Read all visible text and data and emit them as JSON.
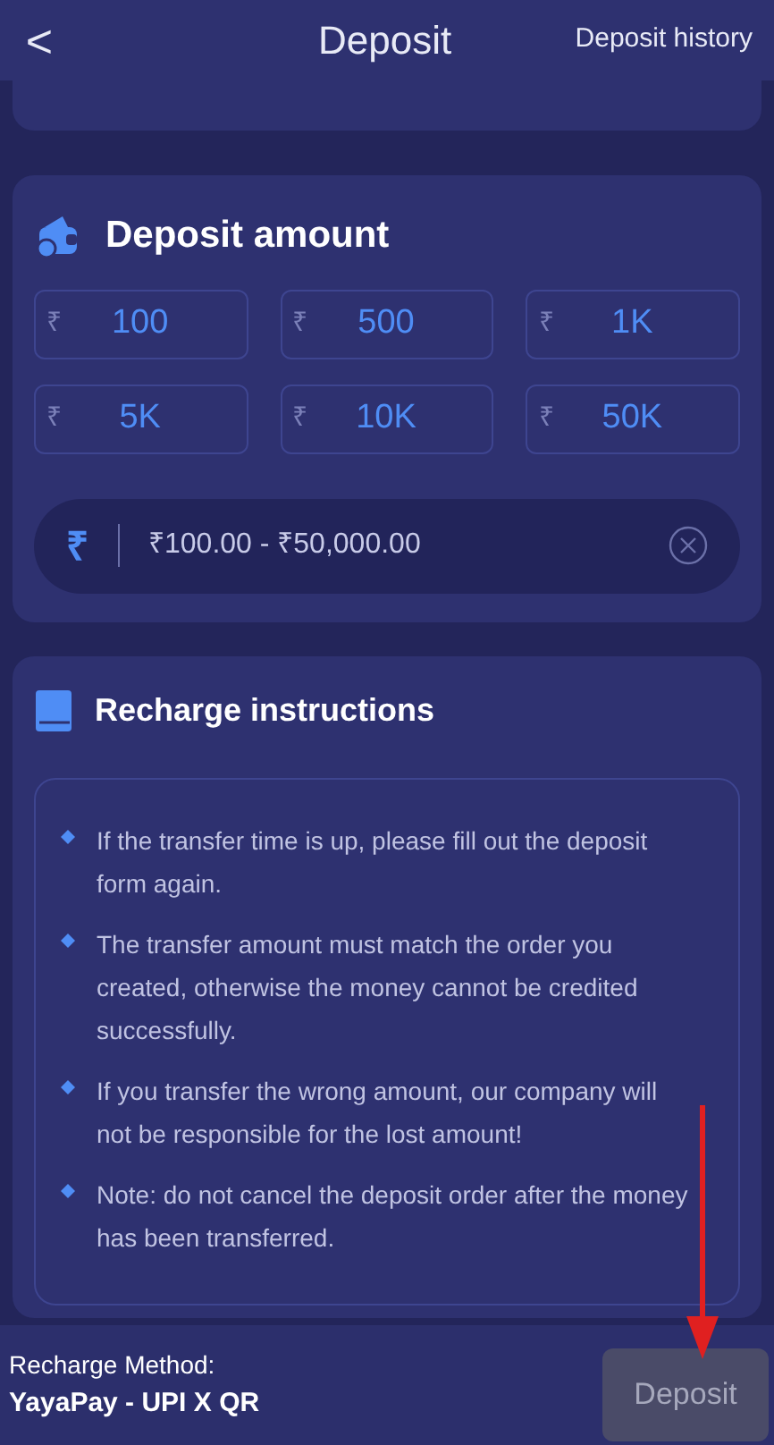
{
  "header": {
    "back": "<",
    "title": "Deposit",
    "history_link": "Deposit history"
  },
  "deposit_amount": {
    "title": "Deposit amount",
    "currency": "₹",
    "amounts": [
      "100",
      "500",
      "1K",
      "5K",
      "10K",
      "50K"
    ],
    "input": {
      "currency": "₹",
      "placeholder": "₹100.00 - ₹50,000.00"
    }
  },
  "instructions": {
    "title": "Recharge instructions",
    "items": [
      "If the transfer time is up, please fill out the deposit form again.",
      "The transfer amount must match the order you created, otherwise the money cannot be credited successfully.",
      "If you transfer the wrong amount, our company will not be responsible for the lost amount!",
      "Note: do not cancel the deposit order after the money has been transferred."
    ]
  },
  "footer": {
    "method_label": "Recharge Method:",
    "method_value": "YayaPay - UPI X QR",
    "deposit_button": {
      "label": "Deposit",
      "disabled": true
    }
  }
}
